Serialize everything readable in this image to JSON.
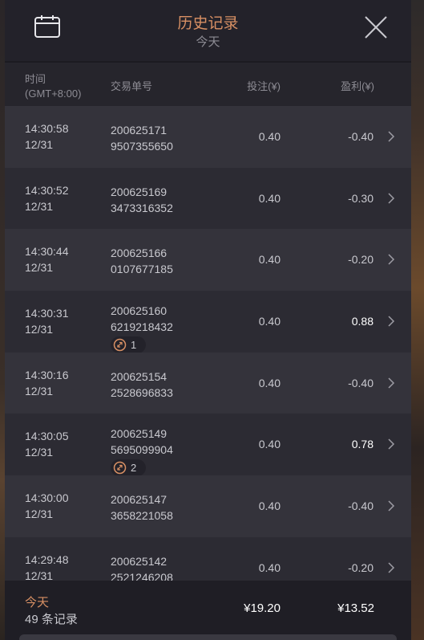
{
  "header": {
    "title": "历史记录",
    "subtitle": "今天",
    "calendar_icon": "calendar-icon",
    "close_icon": "close-icon"
  },
  "columns": {
    "time": "时间",
    "timezone": "(GMT+8:00)",
    "order": "交易单号",
    "bet": "投注(¥)",
    "profit": "盈利(¥)"
  },
  "rows": [
    {
      "time": "14:30:58",
      "date": "12/31",
      "id1": "200625171",
      "id2": "9507355650",
      "bet": "0.40",
      "profit": "-0.40",
      "badge": ""
    },
    {
      "time": "14:30:52",
      "date": "12/31",
      "id1": "200625169",
      "id2": "3473316352",
      "bet": "0.40",
      "profit": "-0.30",
      "badge": ""
    },
    {
      "time": "14:30:44",
      "date": "12/31",
      "id1": "200625166",
      "id2": "0107677185",
      "bet": "0.40",
      "profit": "-0.20",
      "badge": ""
    },
    {
      "time": "14:30:31",
      "date": "12/31",
      "id1": "200625160",
      "id2": "6219218432",
      "bet": "0.40",
      "profit": "0.88",
      "badge": "1"
    },
    {
      "time": "14:30:16",
      "date": "12/31",
      "id1": "200625154",
      "id2": "2528696833",
      "bet": "0.40",
      "profit": "-0.40",
      "badge": ""
    },
    {
      "time": "14:30:05",
      "date": "12/31",
      "id1": "200625149",
      "id2": "5695099904",
      "bet": "0.40",
      "profit": "0.78",
      "badge": "2"
    },
    {
      "time": "14:30:00",
      "date": "12/31",
      "id1": "200625147",
      "id2": "3658221058",
      "bet": "0.40",
      "profit": "-0.40",
      "badge": ""
    },
    {
      "time": "14:29:48",
      "date": "12/31",
      "id1": "200625142",
      "id2": "2521246208",
      "bet": "0.40",
      "profit": "-0.20",
      "badge": ""
    }
  ],
  "footer": {
    "today": "今天",
    "count": "49 条记录",
    "total_bet": "¥19.20",
    "total_profit": "¥13.52"
  },
  "colors": {
    "accent": "#d89064",
    "row_odd": "#34333b",
    "row_even": "#2c2b33"
  }
}
